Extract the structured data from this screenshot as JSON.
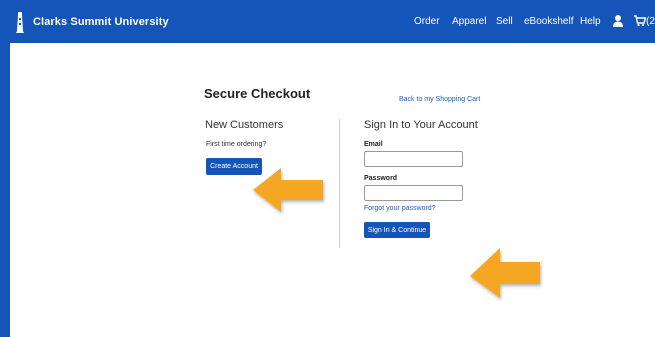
{
  "header": {
    "brand_name": "Clarks Summit University",
    "nav": [
      "Order",
      "Apparel",
      "Sell",
      "eBookshelf",
      "Help"
    ],
    "cart_count": "(2"
  },
  "checkout": {
    "title": "Secure Checkout",
    "back_link": "Back to my Shopping Cart",
    "new_customers": {
      "heading": "New Customers",
      "prompt": "First time ordering?",
      "button": "Create Account"
    },
    "sign_in": {
      "heading": "Sign In to Your Account",
      "email_label": "Email",
      "email_value": "",
      "password_label": "Password",
      "password_value": "",
      "forgot_link": "Forgot your password?",
      "button": "Sign In & Continue"
    }
  },
  "colors": {
    "brand_blue": "#1554b8",
    "arrow_orange": "#f5a623"
  },
  "icons": {
    "logo": "lighthouse-icon",
    "account": "user-icon",
    "cart": "cart-icon",
    "annotation": "arrow-left-icon"
  }
}
